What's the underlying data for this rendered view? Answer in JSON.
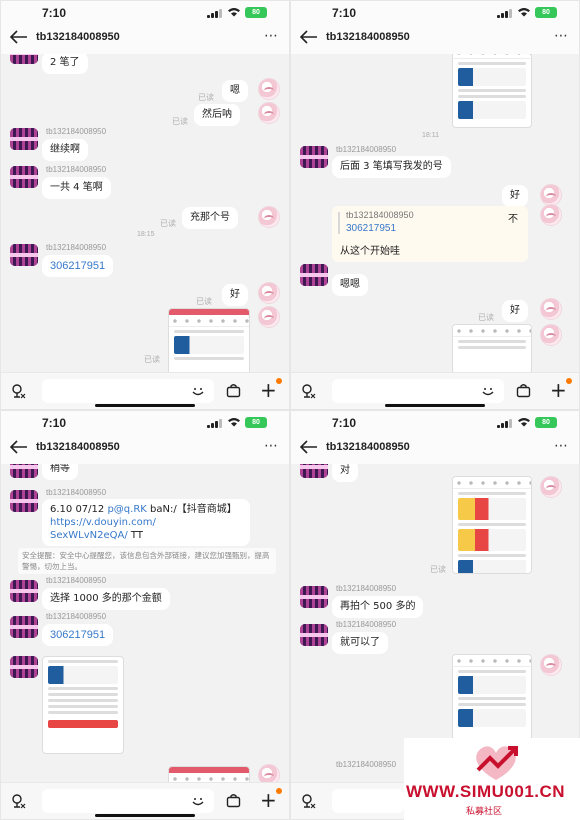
{
  "status": {
    "time": "7:10",
    "battery": "80"
  },
  "contact": "tb132184008950",
  "read": "已读",
  "tl": {
    "m1": "2 笔了",
    "m2": "嗯",
    "m3": "然后呐",
    "m4": "继续啊",
    "m5": "一共 4 笔啊",
    "m6": "充那个号",
    "ts": "18:15",
    "m7": "306217951",
    "m8": "好"
  },
  "tr": {
    "ts": "18:11",
    "m1": "后面 3 笔填写我发的号",
    "m2": "好",
    "quote_name": "tb132184008950",
    "quote_text": "306217951",
    "m3": "不",
    "m4": "从这个开始哇",
    "m5": "嗯嗯",
    "m6": "好"
  },
  "bl": {
    "m0": "稍等",
    "m1a": "6.10 07/12 ",
    "m1b": "p@q.RK",
    "m1c": " baN:/【抖音商城】",
    "m1d": "https://v.douyin.com/",
    "m1e": "SexWLvN2eQA/",
    "m1f": " TT",
    "warn": "安全提醒：安全中心提醒您，该信息包含外部链接，建议您加强甄别，提高警惕，切勿上当。",
    "m2": "选择 1000 多的那个金额",
    "m3": "306217951"
  },
  "br": {
    "m0": "对",
    "m1": "再拍个 500 多的",
    "m2": "就可以了"
  },
  "watermark": {
    "site": "WWW.SIMU001.CN",
    "sub": "私募社区"
  },
  "colors": {
    "accent": "#ff7a00",
    "link": "#3778c9",
    "watermark": "#c8102e",
    "battery": "#35c759"
  }
}
